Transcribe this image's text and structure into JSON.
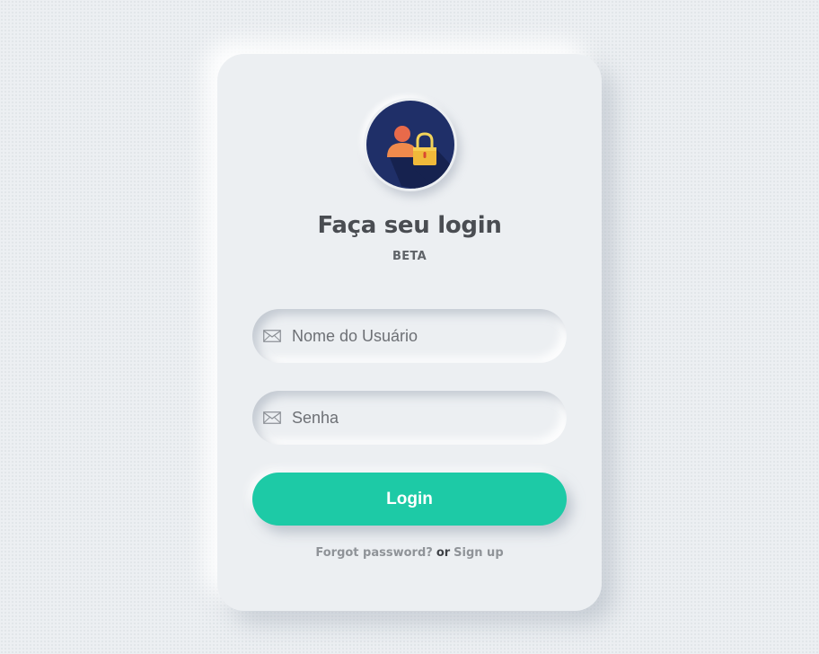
{
  "login_card": {
    "logo_icon": "user-lock-icon",
    "title": "Faça seu login",
    "subtitle": "BETA",
    "username": {
      "placeholder": "Nome do Usuário",
      "value": "",
      "icon": "envelope-icon"
    },
    "password": {
      "placeholder": "Senha",
      "value": "",
      "icon": "envelope-icon"
    },
    "login_button": "Login",
    "footer": {
      "forgot_password": "Forgot password?",
      "separator": "or",
      "sign_up": "Sign up"
    }
  },
  "colors": {
    "background": "#eceff2",
    "accent": "#1dcaa6",
    "logo_circle": "#1f2f68",
    "title_text": "#4a4d52",
    "link_text": "#8f9398"
  }
}
